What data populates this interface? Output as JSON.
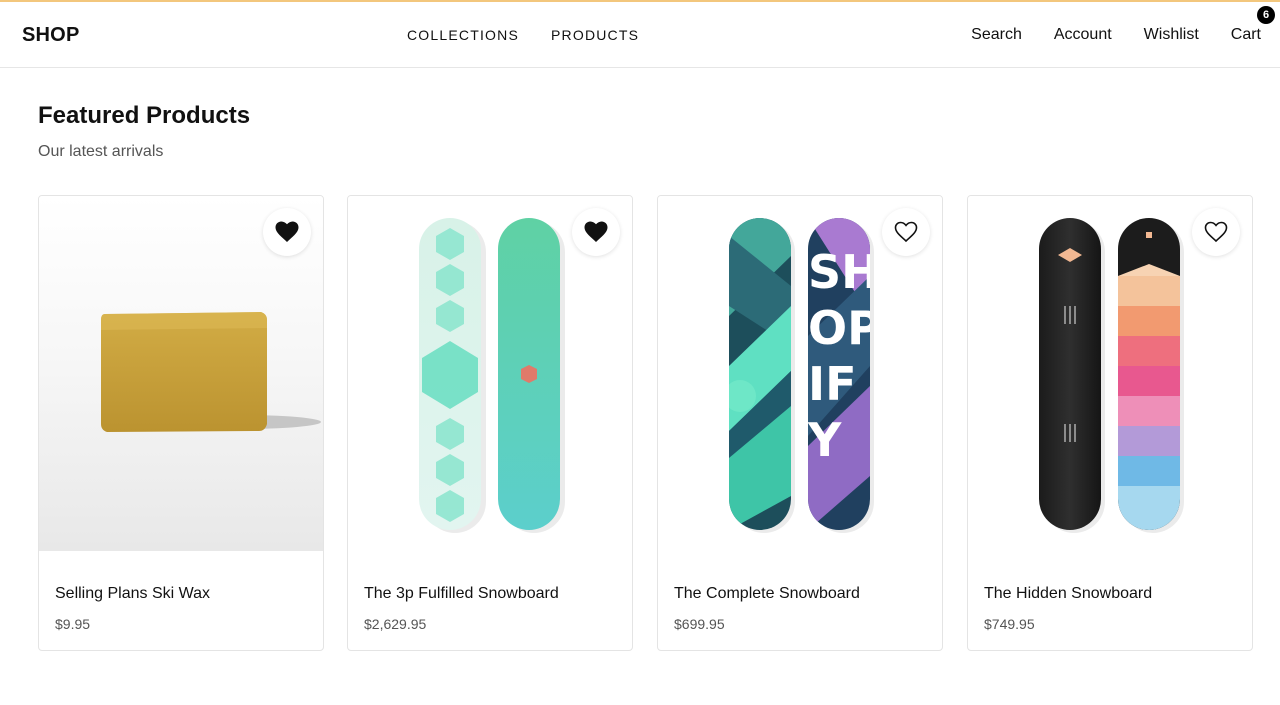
{
  "header": {
    "logo": "SHOP",
    "nav": [
      {
        "label": "COLLECTIONS"
      },
      {
        "label": "PRODUCTS"
      }
    ],
    "user_nav": {
      "search": "Search",
      "account": "Account",
      "wishlist": "Wishlist",
      "cart": "Cart",
      "cart_count": "6"
    }
  },
  "section": {
    "title": "Featured Products",
    "subtitle": "Our latest arrivals"
  },
  "products": [
    {
      "title": "Selling Plans Ski Wax",
      "price": "$9.95",
      "wishlisted": true,
      "image": "ski-wax-bar"
    },
    {
      "title": "The 3p Fulfilled Snowboard",
      "price": "$2,629.95",
      "wishlisted": true,
      "image": "mint-hexagon-snowboards"
    },
    {
      "title": "The Complete Snowboard",
      "price": "$699.95",
      "wishlisted": false,
      "image": "teal-purple-shopify-snowboards"
    },
    {
      "title": "The Hidden Snowboard",
      "price": "$749.95",
      "wishlisted": false,
      "image": "black-and-rainbow-snowboards"
    }
  ],
  "colors": {
    "accent_line": "#f3c77d",
    "text": "#111111",
    "muted": "#555555",
    "border": "#e4e4e4"
  }
}
